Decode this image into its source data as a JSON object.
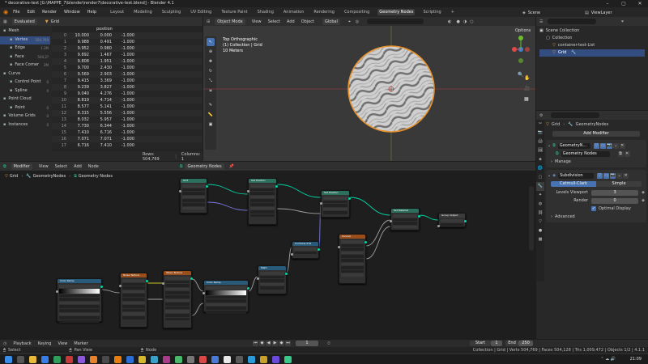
{
  "window": {
    "title": "* decorative-test [G:\\MAPPE_7\\blender\\render7\\decorative-test.blend] - Blender 4.1"
  },
  "menus": [
    "File",
    "Edit",
    "Render",
    "Window",
    "Help"
  ],
  "workspaces": [
    "Layout",
    "Modeling",
    "Sculpting",
    "UV Editing",
    "Texture Paint",
    "Shading",
    "Animation",
    "Rendering",
    "Compositing",
    "Geometry Nodes",
    "Scripting"
  ],
  "active_workspace": "Geometry Nodes",
  "scene": "Scene",
  "view_layer": "ViewLayer",
  "spreadsheet": {
    "evaluated": "Evaluated",
    "object": "Grid",
    "column_header": "position",
    "tree": [
      {
        "label": "Mesh",
        "count": "",
        "indent": 0
      },
      {
        "label": "Vertex",
        "count": "504,769",
        "indent": 1,
        "active": true
      },
      {
        "label": "Edge",
        "count": "1.2M",
        "indent": 1
      },
      {
        "label": "Face",
        "count": "504,2?",
        "indent": 1
      },
      {
        "label": "Face Corner",
        "count": "2M",
        "indent": 1
      },
      {
        "label": "Curve",
        "count": "",
        "indent": 0
      },
      {
        "label": "Control Point",
        "count": "0",
        "indent": 1
      },
      {
        "label": "Spline",
        "count": "0",
        "indent": 1
      },
      {
        "label": "Point Cloud",
        "count": "",
        "indent": 0
      },
      {
        "label": "Point",
        "count": "0",
        "indent": 1
      },
      {
        "label": "Volume Grids",
        "count": "0",
        "indent": 0
      },
      {
        "label": "Instances",
        "count": "0",
        "indent": 0
      }
    ],
    "rows": [
      [
        "0",
        "10.000",
        "0.000",
        "-1.000"
      ],
      [
        "1",
        "9.988",
        "0.491",
        "-1.000"
      ],
      [
        "2",
        "9.952",
        "0.980",
        "-1.000"
      ],
      [
        "3",
        "9.892",
        "1.467",
        "-1.000"
      ],
      [
        "4",
        "9.808",
        "1.951",
        "-1.000"
      ],
      [
        "5",
        "9.700",
        "2.430",
        "-1.000"
      ],
      [
        "6",
        "9.569",
        "2.903",
        "-1.000"
      ],
      [
        "7",
        "9.415",
        "3.369",
        "-1.000"
      ],
      [
        "8",
        "9.239",
        "3.827",
        "-1.000"
      ],
      [
        "9",
        "9.040",
        "4.276",
        "-1.000"
      ],
      [
        "10",
        "8.819",
        "4.714",
        "-1.000"
      ],
      [
        "11",
        "8.577",
        "5.141",
        "-1.000"
      ],
      [
        "12",
        "8.315",
        "5.556",
        "-1.000"
      ],
      [
        "13",
        "8.032",
        "5.957",
        "-1.000"
      ],
      [
        "14",
        "7.730",
        "6.344",
        "-1.000"
      ],
      [
        "15",
        "7.410",
        "6.716",
        "-1.000"
      ],
      [
        "16",
        "7.071",
        "7.071",
        "-1.000"
      ],
      [
        "17",
        "6.716",
        "7.410",
        "-1.000"
      ]
    ],
    "footer_rows": "Rows: 504,769",
    "footer_cols": "Columns: 1"
  },
  "viewport": {
    "mode": "Object Mode",
    "menus": [
      "View",
      "Select",
      "Add",
      "Object"
    ],
    "orientation": "Global",
    "options": "Options",
    "overlay_line1": "Top Orthographic",
    "overlay_line2": "(1) Collection | Grid",
    "overlay_line3": "10 Meters"
  },
  "outliner": {
    "title": "Scene Collection",
    "items": [
      "Collection",
      "container-test-List",
      "Grid"
    ]
  },
  "properties": {
    "breadcrumb": [
      "Grid",
      "GeometryNodes"
    ],
    "add_modifier": "Add Modifier",
    "mod1_name": "GeometryN...",
    "group_name": "Geometry Nodes",
    "manage": "Manage",
    "mod2_name": "Subdivision",
    "tab1": "Catmull-Clark",
    "tab2": "Simple",
    "levels_label": "Levels Viewport",
    "levels_val": "3",
    "render_label": "Render",
    "render_val": "0",
    "optimal": "Optimal Display",
    "advanced": "Advanced"
  },
  "node_editor": {
    "header_type": "Modifier",
    "menus": [
      "View",
      "Select",
      "Add",
      "Node"
    ],
    "tree_name": "Geometry Nodes",
    "breadcrumb": [
      "Grid",
      "GeometryNodes",
      "Geometry Nodes"
    ],
    "nodes": [
      {
        "name": "Grid",
        "color": "#2c6f5d"
      },
      {
        "name": "Set Position",
        "color": "#2c6f5d"
      },
      {
        "name": "Set Position",
        "color": "#2c6f5d"
      },
      {
        "name": "Set Material",
        "color": "#2c6f5d"
      },
      {
        "name": "Group Output",
        "color": "#3b3b3b"
      },
      {
        "name": "Combine XYZ",
        "color": "#2a5a7a"
      },
      {
        "name": "Voronoi",
        "color": "#9a4e1c"
      },
      {
        "name": "Math",
        "color": "#2a5a7a"
      },
      {
        "name": "Color Ramp",
        "color": "#2a5a7a"
      },
      {
        "name": "Noise Texture",
        "color": "#9a4e1c"
      },
      {
        "name": "Wave Texture",
        "color": "#9a4e1c"
      },
      {
        "name": "Color Ramp",
        "color": "#2a5a7a"
      },
      {
        "name": "Multiply",
        "color": "#2a5a7a"
      }
    ]
  },
  "timeline": {
    "playback": "Playback",
    "keying": "Keying",
    "view": "View",
    "marker": "Marker",
    "current": "1",
    "start_label": "Start",
    "start": "1",
    "end_label": "End",
    "end": "250"
  },
  "status": {
    "select": "Select",
    "pan": "Pan View",
    "node": "Node",
    "stats": "Collection | Grid | Verts 504,769 | Faces 504,128 | Tris 1,009,472 | Objects 1/2 | 4.1.1"
  },
  "taskbar": {
    "time": "21:09"
  }
}
